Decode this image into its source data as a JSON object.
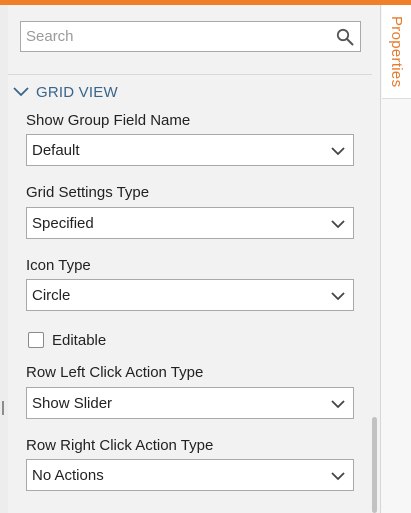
{
  "colors": {
    "accent": "#f07f2a",
    "section_header": "#39658a",
    "tab_label": "#e67a2c"
  },
  "search": {
    "placeholder": "Search",
    "value": "",
    "icon": "search-icon"
  },
  "side_tab": {
    "label": "Properties"
  },
  "section": {
    "title": "GRID VIEW",
    "icon": "chevron-down-icon"
  },
  "fields": {
    "show_group_field_name": {
      "label": "Show Group Field Name",
      "value": "Default"
    },
    "grid_settings_type": {
      "label": "Grid Settings Type",
      "value": "Specified"
    },
    "icon_type": {
      "label": "Icon Type",
      "value": "Circle"
    },
    "editable": {
      "label": "Editable",
      "checked": false
    },
    "row_left_click_action_type": {
      "label": "Row Left Click Action Type",
      "value": "Show Slider"
    },
    "row_right_click_action_type": {
      "label": "Row Right Click Action Type",
      "value": "No Actions"
    }
  }
}
